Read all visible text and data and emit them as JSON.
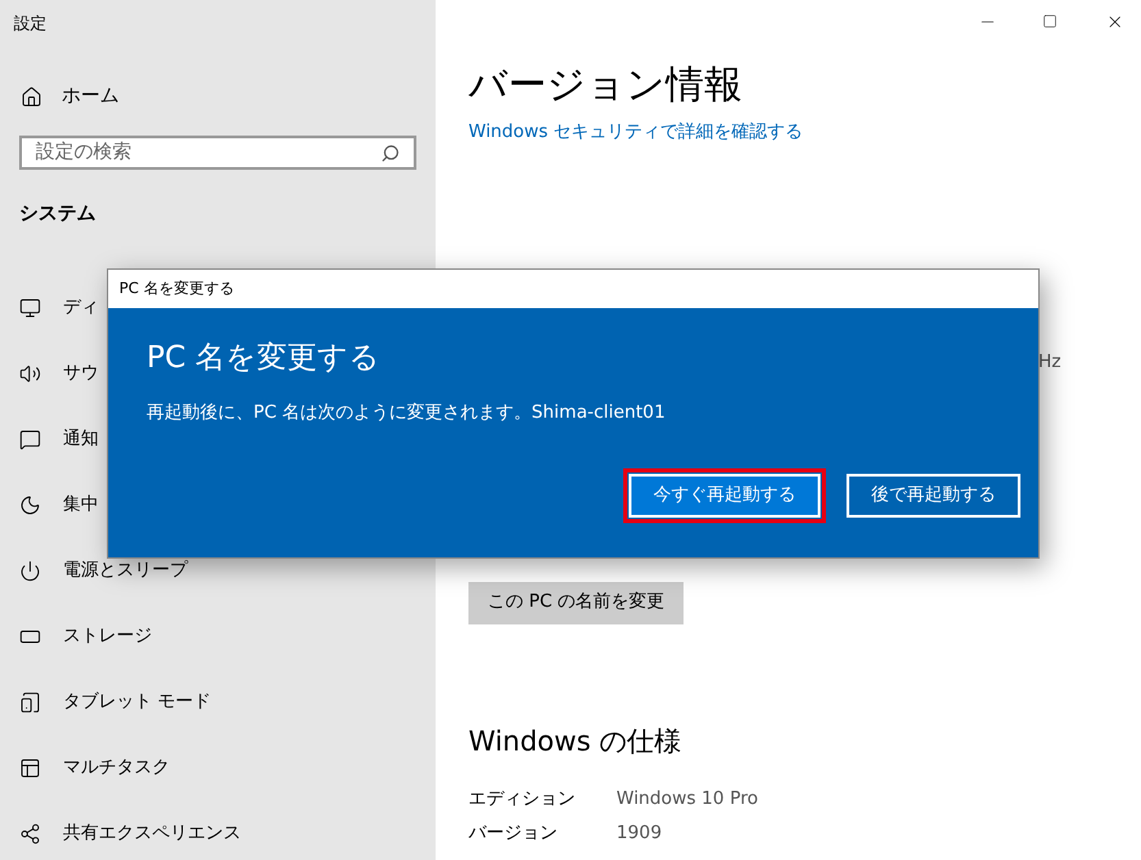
{
  "window": {
    "title": "設定"
  },
  "sidebar": {
    "home": "ホーム",
    "search": {
      "placeholder": "設定の検索"
    },
    "section": "システム",
    "items": [
      {
        "kind": "display",
        "label": "ディ"
      },
      {
        "kind": "sound",
        "label": "サウ"
      },
      {
        "kind": "notify",
        "label": "通知"
      },
      {
        "kind": "focus",
        "label": "集中"
      },
      {
        "kind": "power",
        "label": "電源とスリープ"
      },
      {
        "kind": "storage",
        "label": "ストレージ"
      },
      {
        "kind": "tablet",
        "label": "タブレット モード"
      },
      {
        "kind": "multitask",
        "label": "マルチタスク"
      },
      {
        "kind": "share",
        "label": "共有エクスペリエンス"
      }
    ]
  },
  "main": {
    "title": "バージョン情報",
    "link": "Windows セキュリティで詳細を確認する",
    "fragment": "Hz",
    "rename_button": "この PC の名前を変更",
    "spec_title": "Windows の仕様",
    "specs": [
      {
        "label": "エディション",
        "value": "Windows 10 Pro"
      },
      {
        "label": "バージョン",
        "value": "1909"
      }
    ]
  },
  "dialog": {
    "title": "PC 名を変更する",
    "heading": "PC 名を変更する",
    "message": "再起動後に、PC 名は次のように変更されます。Shima-client01",
    "buttons": [
      {
        "label": "今すぐ再起動する",
        "highlighted": true
      },
      {
        "label": "後で再起動する",
        "highlighted": false
      }
    ]
  }
}
